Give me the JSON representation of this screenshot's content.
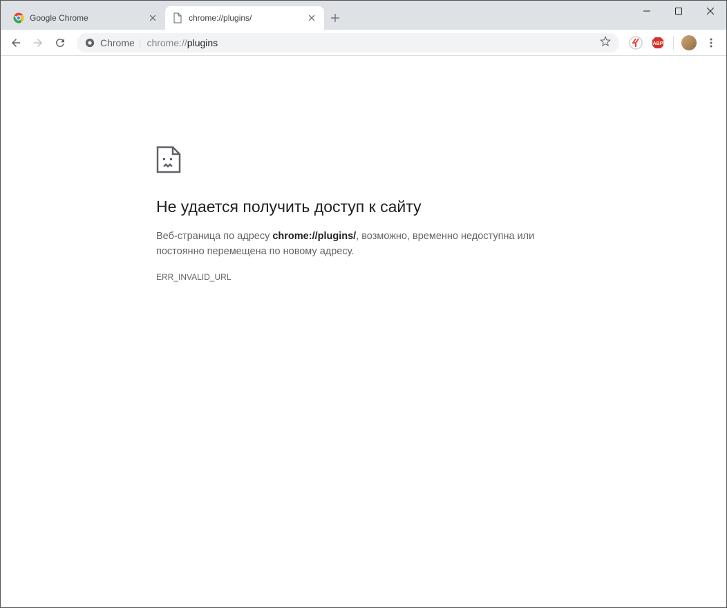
{
  "tabs": [
    {
      "title": "Google Chrome"
    },
    {
      "title": "chrome://plugins/"
    }
  ],
  "omnibox": {
    "scheme_label": "Chrome",
    "url_dim": "chrome://",
    "url_bold": "plugins"
  },
  "error": {
    "title": "Не удается получить доступ к сайту",
    "desc_before": "Веб-страница по адресу ",
    "desc_url": "chrome://plugins/",
    "desc_after": ", возможно, временно недоступна или постоянно перемещена по новому адресу.",
    "code": "ERR_INVALID_URL"
  }
}
